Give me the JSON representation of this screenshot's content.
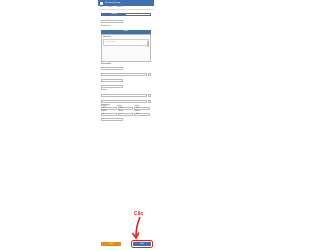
{
  "app": {
    "title": "Kfz-Versicherung"
  },
  "tabs": [
    "Tarif",
    "Daten",
    "Antrag"
  ],
  "segment": {
    "active": "Fahrzeug",
    "inactive": "Fahrer"
  },
  "vehicle": {
    "type_label": "Fahrzeugtyp",
    "type_value": "PKW",
    "hint": "Bitte geben Sie die Daten Ihres Fahrzeugs ein. HSN und TSN finden Sie im Fahrzeugschein."
  },
  "panel": {
    "bar_label": "Hinweis",
    "title": "Datenschutz",
    "text": "Ihre Angaben werden ausschließlich zur Berechnung des Tarifs verwendet und vertraulich behandelt."
  },
  "form": {
    "section": "Fahrzeugdaten",
    "fields": [
      {
        "label": "Hersteller",
        "value": "Volkswagen"
      },
      {
        "label": "Modell",
        "value": "Golf"
      },
      {
        "label": "Erstzulassung",
        "value": "03/2018"
      },
      {
        "label": "Kennzeichen",
        "value": "B-AB 1234"
      }
    ],
    "more_section": "Nutzung",
    "more_fields": [
      {
        "label": "Jahresfahrleistung",
        "value": "12.000"
      },
      {
        "label": "Abstellort",
        "value": "Garage"
      }
    ],
    "grid_section": "Versicherung",
    "grid": [
      {
        "label": "SF-Klasse",
        "value": "SF 5"
      },
      {
        "label": "Beginn",
        "value": "01.01."
      },
      {
        "label": "Zahlung",
        "value": "jährl."
      }
    ],
    "grid2": [
      {
        "label": "Haftpflicht",
        "value": "Ja"
      },
      {
        "label": "Teilkasko",
        "value": "Ja"
      },
      {
        "label": "Vollkasko",
        "value": "Nein"
      }
    ],
    "extra_label": "Selbstbeteiligung",
    "extra_value": "300 €"
  },
  "footer": {
    "back_label": "Zurück",
    "next_label": "Weiter"
  },
  "annotation": {
    "text": "Clic"
  }
}
